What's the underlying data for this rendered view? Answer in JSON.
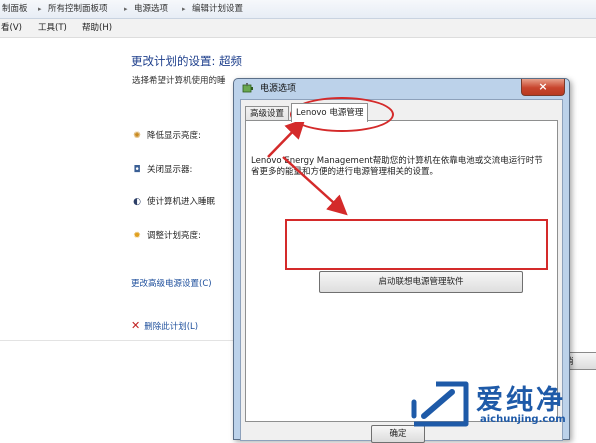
{
  "breadcrumb": {
    "items": [
      "制面板",
      "所有控制面板项",
      "电源选项",
      "编辑计划设置"
    ]
  },
  "menu": {
    "items": [
      "看(V)",
      "工具(T)",
      "帮助(H)"
    ]
  },
  "main": {
    "title": "更改计划的设置: 超频",
    "subtitle": "选择希望计算机使用的睡",
    "settings": [
      {
        "label": "降低显示亮度:",
        "icon": "sun-dim-icon"
      },
      {
        "label": "关闭显示器:",
        "icon": "monitor-icon"
      },
      {
        "label": "使计算机进入睡眠",
        "icon": "moon-icon"
      },
      {
        "label": "调整计划亮度:",
        "icon": "sun-bright-icon"
      }
    ],
    "advanced_link": "更改高级电源设置(C)",
    "delete_link": "删除此计划(L)",
    "partial_button": "消"
  },
  "dialog": {
    "title": "电源选项",
    "close_symbol": "×",
    "tabs": [
      {
        "label": "高级设置",
        "active": false
      },
      {
        "label": "Lenovo 电源管理",
        "active": true
      }
    ],
    "description": "Lenovo Energy Management帮助您的计算机在依靠电池或交流电运行时节省更多的能量和方便的进行电源管理相关的设置。",
    "launch_button": "启动联想电源管理软件",
    "ok_button": "确定"
  },
  "watermark": {
    "cn": "爱纯净",
    "en": "aichunjing.com"
  },
  "colors": {
    "annotation": "#d42a2a",
    "link": "#1e4f9c",
    "title": "#1e3f8c",
    "watermark": "#1e5aa8"
  }
}
